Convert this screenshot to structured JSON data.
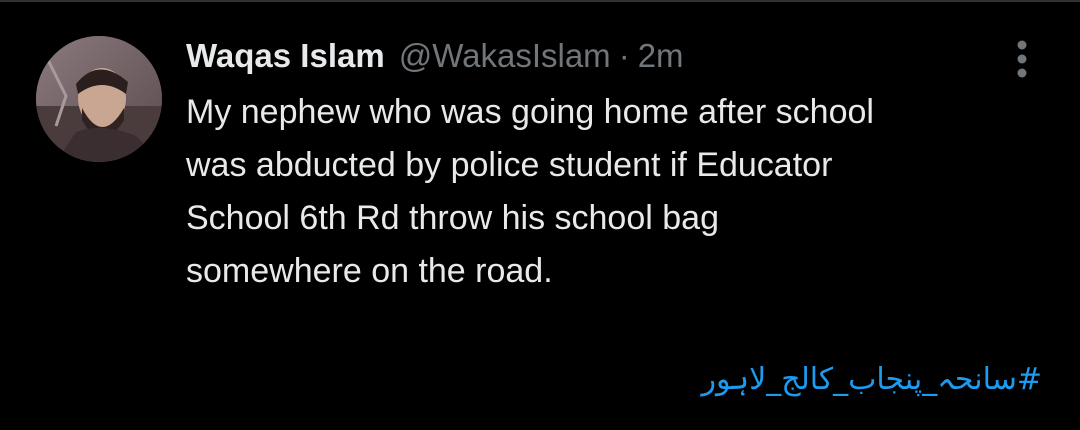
{
  "tweet": {
    "display_name": "Waqas Islam",
    "handle": "@WakasIslam",
    "separator": "·",
    "timestamp": "2m",
    "text": "My nephew who was going home after school\nwas abducted by police student if Educator\nSchool 6th Rd throw his school bag\nsomewhere on the road.",
    "hashtag": "#سانحہ_پنجاب_کالج_لاہور"
  },
  "icons": {
    "avatar": "profile-photo",
    "more": "more-vertical-icon"
  },
  "colors": {
    "background": "#000000",
    "text_primary": "#e7e9ea",
    "text_secondary": "#71767b",
    "link": "#1d9bf0",
    "divider": "#2f3336"
  }
}
